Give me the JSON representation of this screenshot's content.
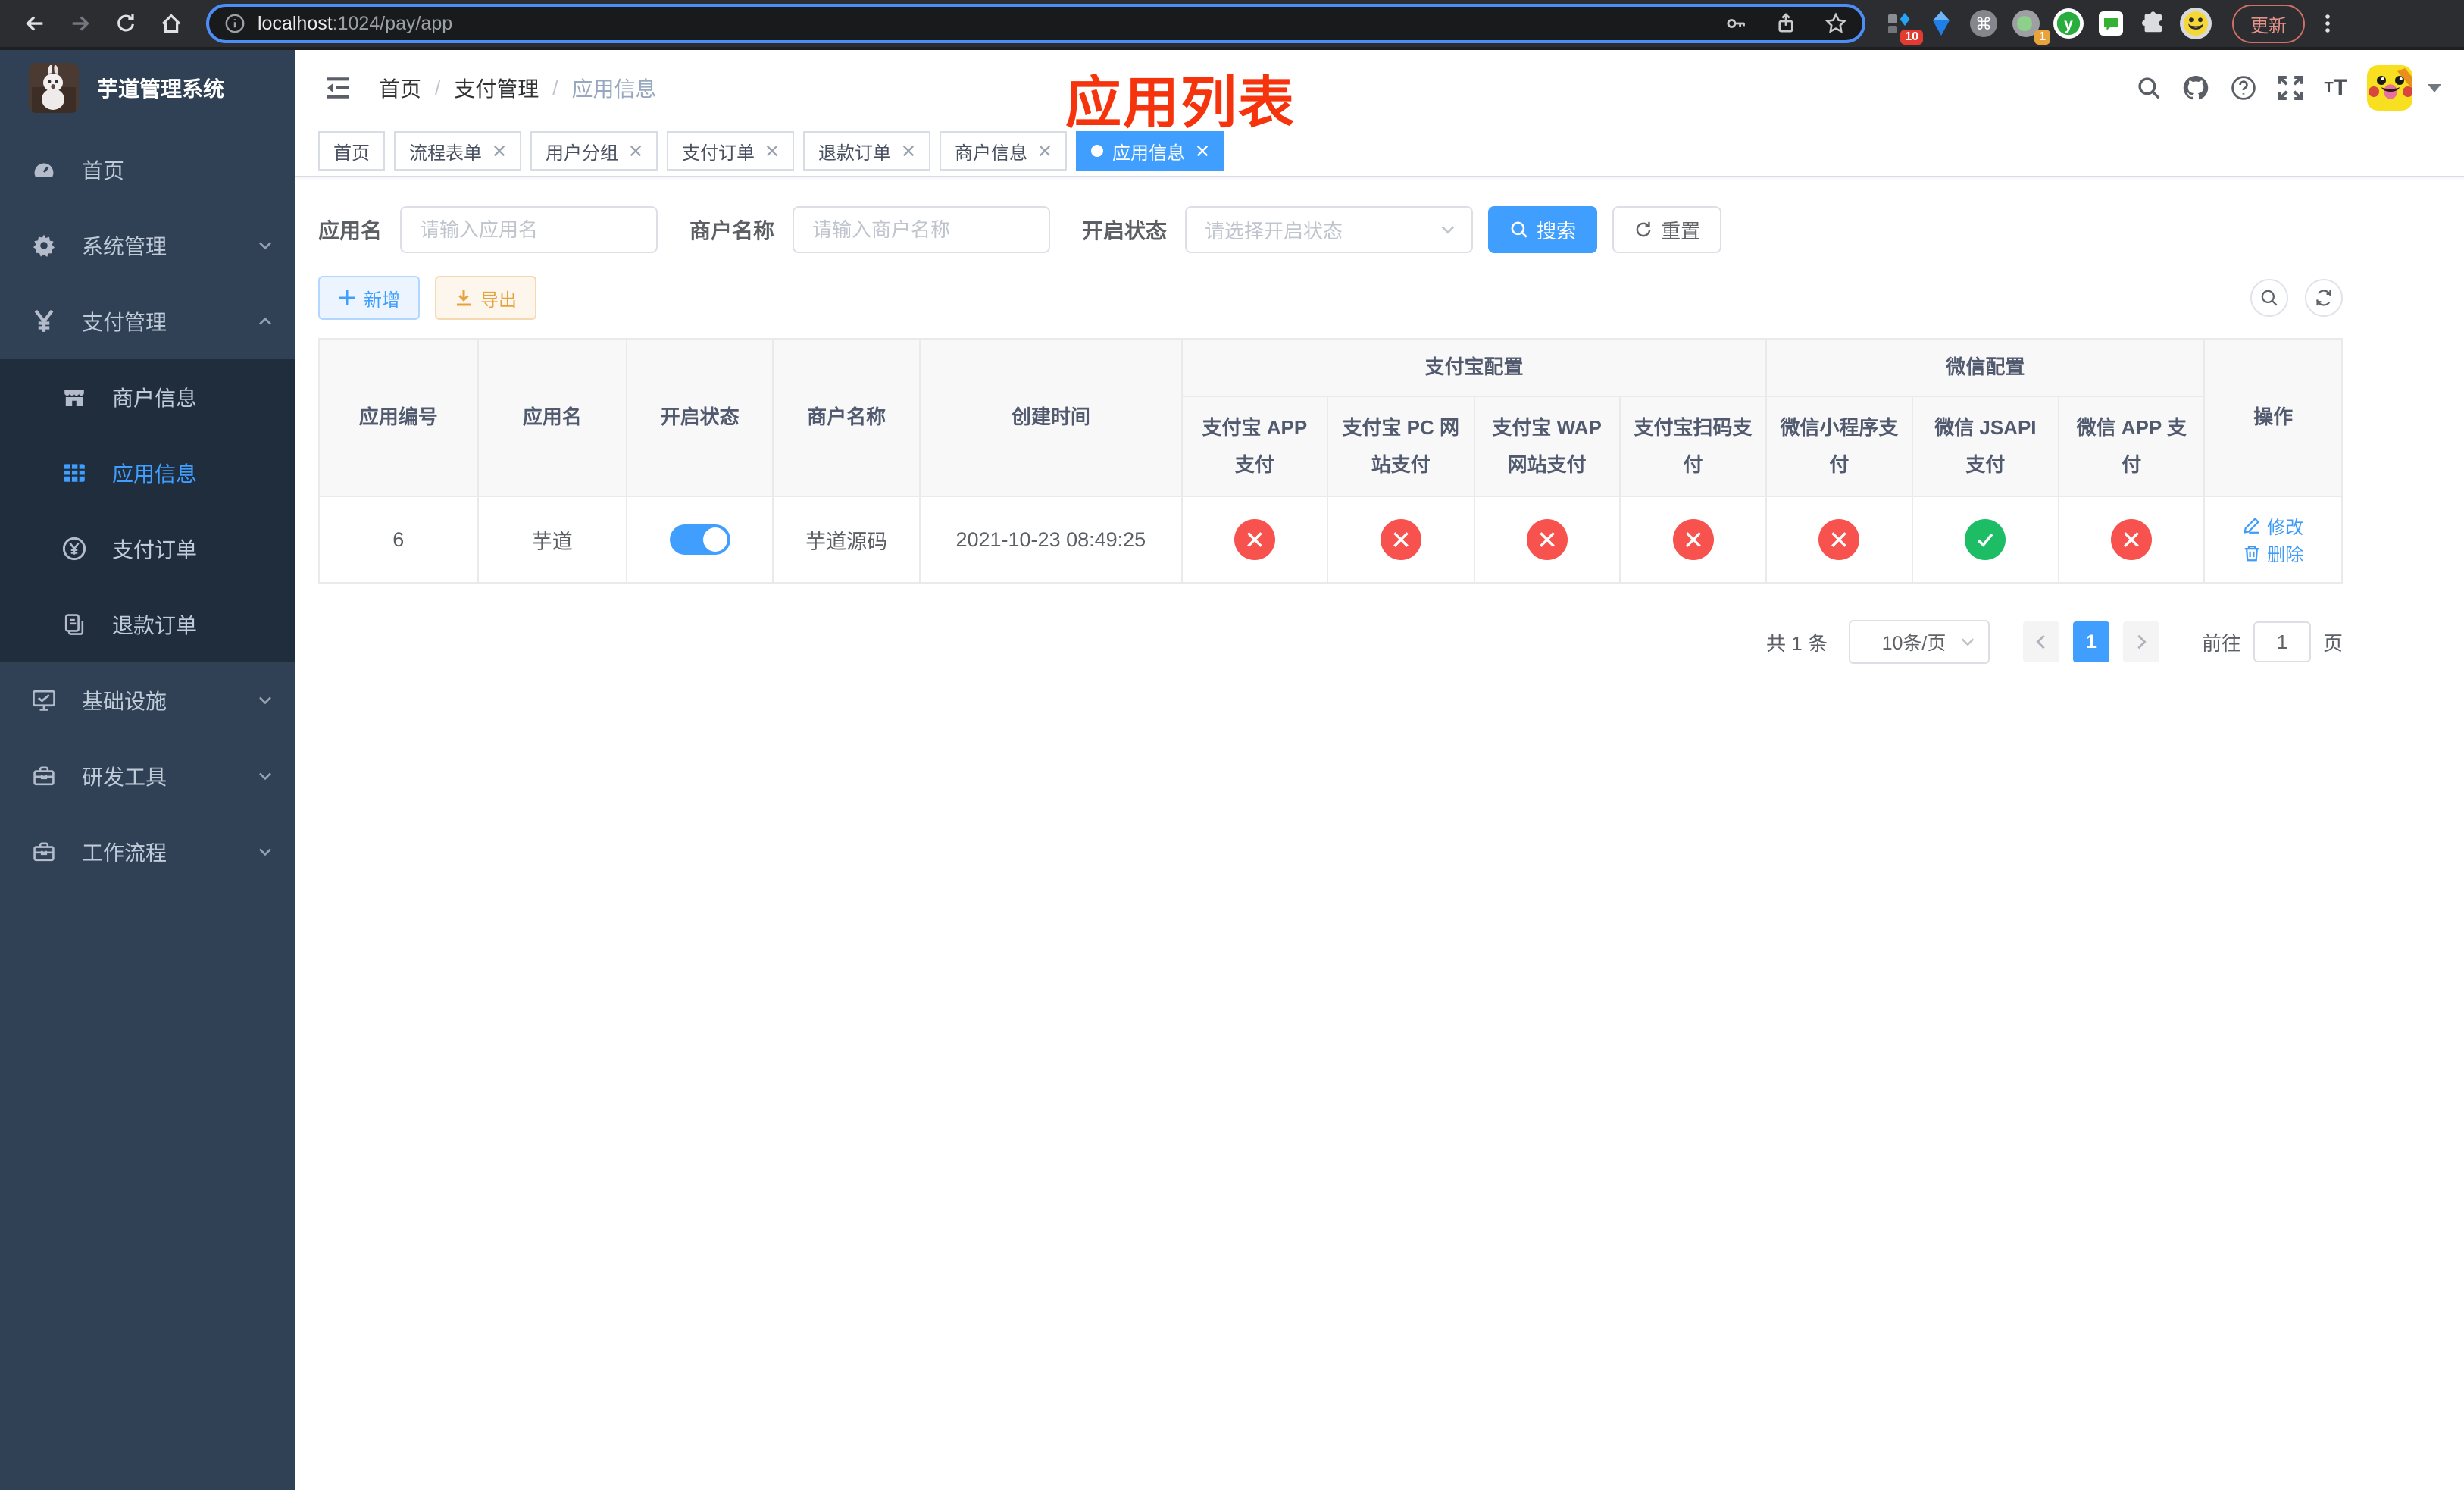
{
  "browser": {
    "url_host": "localhost",
    "url_rest": ":1024/pay/app",
    "ext_badge_1": "10",
    "ext_badge_2": "1",
    "update_label": "更新"
  },
  "sidebar": {
    "logo_title": "芋道管理系统",
    "menu": [
      {
        "slug": "home",
        "label": "首页",
        "icon": "dashboard-icon",
        "type": "item",
        "arrow": "",
        "active": false
      },
      {
        "slug": "system-mgmt",
        "label": "系统管理",
        "icon": "gear-icon",
        "type": "group",
        "arrow": "down",
        "active": false
      },
      {
        "slug": "payment-mgmt",
        "label": "支付管理",
        "icon": "yen-icon",
        "type": "group",
        "arrow": "up",
        "active": false
      },
      {
        "slug": "merchant-info",
        "label": "商户信息",
        "icon": "shop-icon",
        "type": "subitem",
        "arrow": "",
        "active": false
      },
      {
        "slug": "app-info",
        "label": "应用信息",
        "icon": "grid-icon",
        "type": "subitem",
        "arrow": "",
        "active": true
      },
      {
        "slug": "payment-order",
        "label": "支付订单",
        "icon": "coin-icon",
        "type": "subitem",
        "arrow": "",
        "active": false
      },
      {
        "slug": "refund-order",
        "label": "退款订单",
        "icon": "docs-icon",
        "type": "subitem",
        "arrow": "",
        "active": false
      },
      {
        "slug": "infrastructure",
        "label": "基础设施",
        "icon": "monitor-icon",
        "type": "group",
        "arrow": "down",
        "active": false
      },
      {
        "slug": "dev-tools",
        "label": "研发工具",
        "icon": "toolbox-icon",
        "type": "group",
        "arrow": "down",
        "active": false
      },
      {
        "slug": "workflow",
        "label": "工作流程",
        "icon": "toolbox-icon",
        "type": "group",
        "arrow": "down",
        "active": false
      }
    ]
  },
  "header": {
    "breadcrumb": [
      "首页",
      "支付管理",
      "应用信息"
    ],
    "watermark_title": "应用列表"
  },
  "tabs": [
    {
      "slug": "home",
      "label": "首页",
      "closable": false,
      "active": false
    },
    {
      "slug": "process-form",
      "label": "流程表单",
      "closable": true,
      "active": false
    },
    {
      "slug": "user-group",
      "label": "用户分组",
      "closable": true,
      "active": false
    },
    {
      "slug": "payment-order",
      "label": "支付订单",
      "closable": true,
      "active": false
    },
    {
      "slug": "refund-order",
      "label": "退款订单",
      "closable": true,
      "active": false
    },
    {
      "slug": "merchant-info",
      "label": "商户信息",
      "closable": true,
      "active": false
    },
    {
      "slug": "app-info",
      "label": "应用信息",
      "closable": true,
      "active": true
    }
  ],
  "filters": {
    "app_name_label": "应用名",
    "app_name_placeholder": "请输入应用名",
    "app_name_value": "",
    "merchant_label": "商户名称",
    "merchant_placeholder": "请输入商户名称",
    "merchant_value": "",
    "status_label": "开启状态",
    "status_placeholder": "请选择开启状态",
    "search_label": "搜索",
    "reset_label": "重置"
  },
  "toolbar": {
    "add_label": "新增",
    "export_label": "导出"
  },
  "table": {
    "columns": [
      "应用编号",
      "应用名",
      "开启状态",
      "商户名称",
      "创建时间"
    ],
    "groups": [
      {
        "label": "支付宝配置",
        "children": [
          "支付宝 APP 支付",
          "支付宝 PC 网站支付",
          "支付宝 WAP 网站支付",
          "支付宝扫码支付"
        ]
      },
      {
        "label": "微信配置",
        "children": [
          "微信小程序支付",
          "微信 JSAPI 支付",
          "微信 APP 支付"
        ]
      }
    ],
    "ops_label": "操作",
    "rows": [
      {
        "id": "6",
        "name": "芋道",
        "enabled": true,
        "merchant": "芋道源码",
        "created_at": "2021-10-23 08:49:25",
        "alipay": [
          false,
          false,
          false,
          false
        ],
        "wechat": [
          false,
          true,
          false
        ],
        "actions": [
          "修改",
          "删除"
        ]
      }
    ]
  },
  "pagination": {
    "total_text": "共 1 条",
    "page_size": "10条/页",
    "current_page": "1",
    "goto_label": "前往",
    "goto_value": "1",
    "page_suffix": "页"
  },
  "colors": {
    "accent": "#409eff",
    "success": "#1cbd64",
    "danger": "#f7524d",
    "warning": "#e6a23c",
    "watermark_red": "#f5330c",
    "sidebar_bg": "#304156",
    "submenu_bg": "#1f2d3d"
  }
}
